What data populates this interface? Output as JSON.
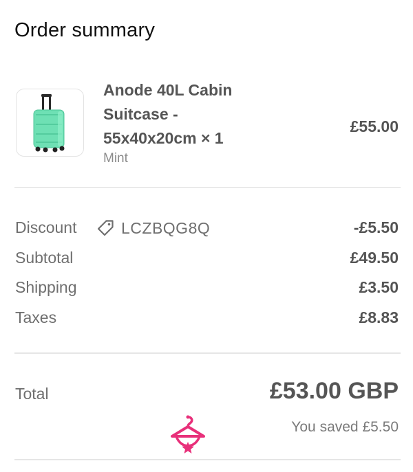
{
  "header": {
    "title": "Order summary"
  },
  "product": {
    "name_line1": "Anode 40L Cabin",
    "name_line2": "Suitcase -",
    "name_line3": "55x40x20cm × 1",
    "variant": "Mint",
    "price": "£55.00",
    "thumbnail_icon": "suitcase-icon",
    "thumbnail_color": "#6ee0b4"
  },
  "summary": {
    "discount_label": "Discount",
    "discount_code": "LCZBQG8Q",
    "discount_icon": "tag-icon",
    "discount_value": "-£5.50",
    "subtotal_label": "Subtotal",
    "subtotal_value": "£49.50",
    "shipping_label": "Shipping",
    "shipping_value": "£3.50",
    "taxes_label": "Taxes",
    "taxes_value": "£8.83"
  },
  "total": {
    "label": "Total",
    "value": "£53.00 GBP",
    "saved": "You saved £5.50"
  },
  "watermark": {
    "icon": "hanger-logo-icon",
    "color": "#e8307a"
  }
}
